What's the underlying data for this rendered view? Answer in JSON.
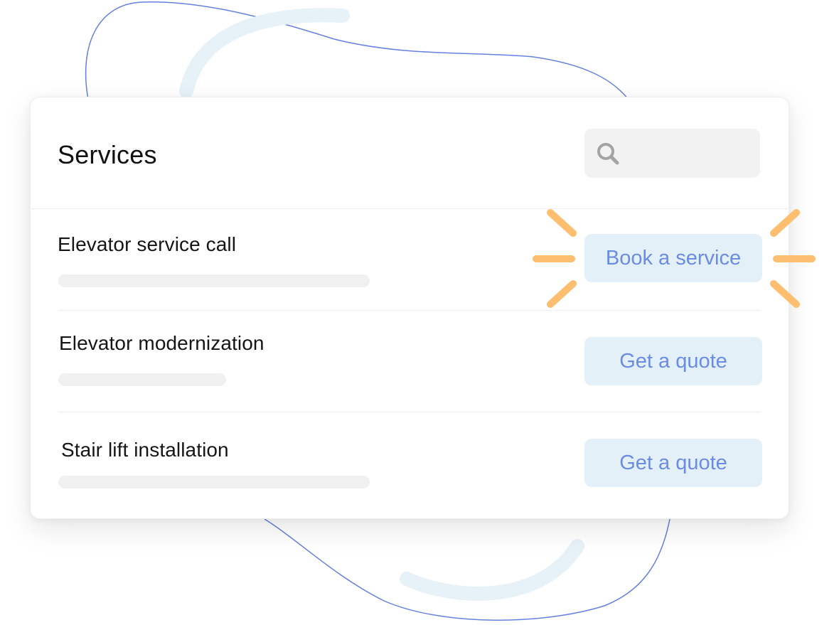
{
  "card": {
    "title": "Services",
    "search": {
      "placeholder": "",
      "value": ""
    }
  },
  "services": [
    {
      "label": "Elevator service call",
      "button": "Book a service",
      "highlighted": true
    },
    {
      "label": "Elevator modernization",
      "button": "Get a quote",
      "highlighted": false
    },
    {
      "label": "Stair lift installation",
      "button": "Get a quote",
      "highlighted": false
    }
  ],
  "colors": {
    "accent_text": "#6b8ce5",
    "button_bg": "#e3f0f8",
    "highlight_spark": "#fdbf6f",
    "decor_line": "#6680e0",
    "decor_arc": "#e7f1f8"
  },
  "icons": {
    "search": "search-icon",
    "highlight": "spark-burst-icon"
  }
}
